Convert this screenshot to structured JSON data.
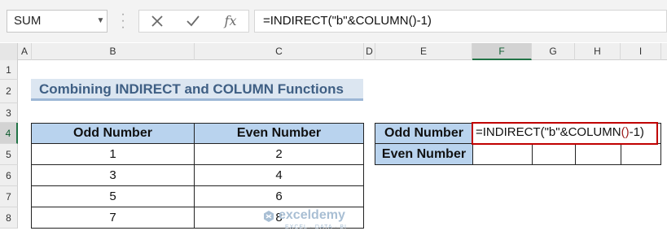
{
  "formula_bar": {
    "name_box": "SUM",
    "formula": "=INDIRECT(\"b\"&COLUMN()-1)",
    "cancel_icon": "x-icon",
    "enter_icon": "check-icon",
    "fx_label": "fx"
  },
  "columns": [
    "A",
    "B",
    "C",
    "D",
    "E",
    "F",
    "G",
    "H",
    "I"
  ],
  "selected_column": "F",
  "rows": [
    "1",
    "2",
    "3",
    "4",
    "5",
    "6",
    "7",
    "8"
  ],
  "selected_row": "4",
  "title": "Combining INDIRECT and COLUMN Functions",
  "table": {
    "headers": [
      "Odd Number",
      "Even Number"
    ],
    "rows": [
      [
        "1",
        "2"
      ],
      [
        "3",
        "4"
      ],
      [
        "5",
        "6"
      ],
      [
        "7",
        "8"
      ]
    ]
  },
  "side_table": {
    "label_odd": "Odd Number",
    "label_even": "Even Number",
    "active_formula_a": "=INDIRECT(\"b\"&COLUMN",
    "active_formula_paren": "()",
    "active_formula_b": "-1)"
  },
  "watermark": {
    "name": "exceldemy",
    "tagline": "EXCEL · DATA · BI"
  }
}
